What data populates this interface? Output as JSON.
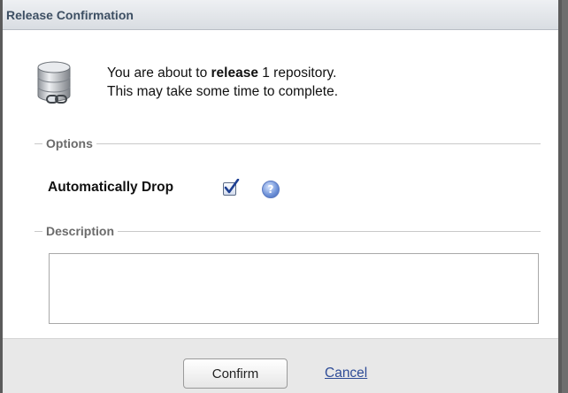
{
  "dialog": {
    "title": "Release Confirmation",
    "message_prefix": "You are about to ",
    "message_action": "release",
    "message_suffix": " 1 repository.",
    "message_line2": "This may take some time to complete.",
    "icon": "repository-database-link-icon"
  },
  "options": {
    "section_label": "Options",
    "auto_drop_label": "Automatically Drop",
    "auto_drop_checked": true,
    "help_icon": "help-question-icon",
    "help_glyph": "?"
  },
  "description": {
    "section_label": "Description",
    "value": ""
  },
  "buttons": {
    "confirm_label": "Confirm",
    "cancel_label": "Cancel"
  },
  "colors": {
    "title_text": "#3d4f63",
    "link": "#2e4c97",
    "checkmark": "#1d3f92"
  }
}
